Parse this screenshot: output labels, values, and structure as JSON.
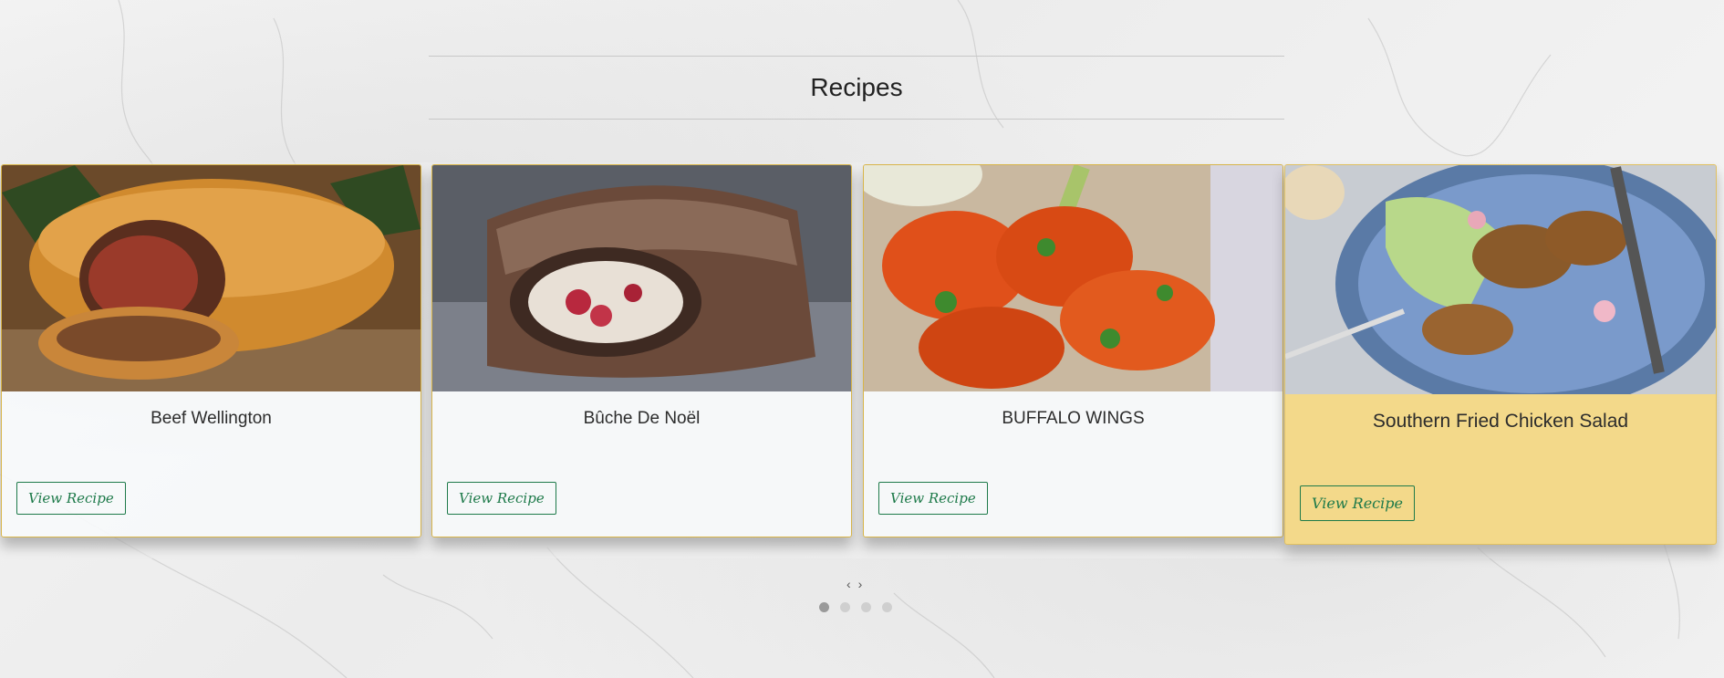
{
  "section": {
    "title": "Recipes"
  },
  "recipes": [
    {
      "title": "Beef Wellington",
      "button": "View Recipe"
    },
    {
      "title": "Bûche De Noël",
      "button": "View Recipe"
    },
    {
      "title": "BUFFALO WINGS",
      "button": "View Recipe"
    },
    {
      "title": "Southern Fried Chicken Salad",
      "button": "View Recipe"
    }
  ],
  "carousel": {
    "prev": "‹",
    "next": "›",
    "active_index": 0,
    "dot_count": 4
  },
  "colors": {
    "accent": "#1e7a4a",
    "card_border": "#d8b54a",
    "active_card": "#f3d98a"
  }
}
